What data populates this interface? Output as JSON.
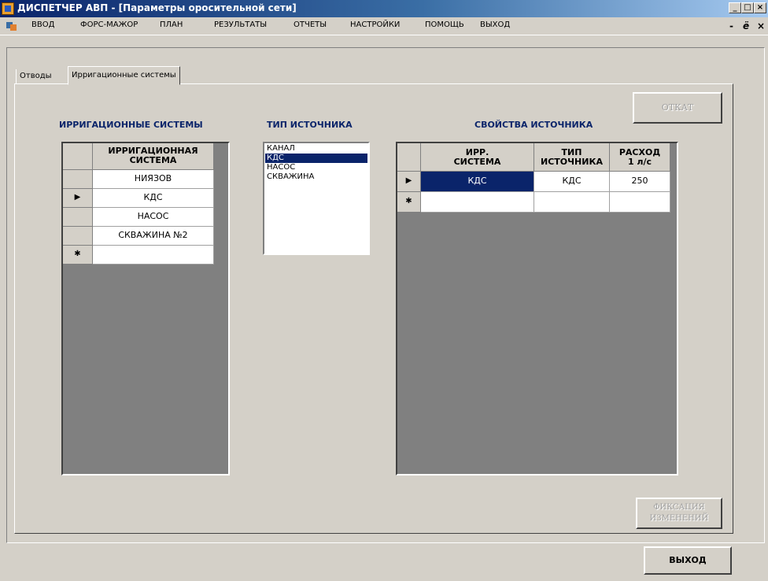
{
  "window": {
    "title": "ДИСПЕТЧЕР АВП - [Параметры оросительной сети]",
    "controls": {
      "minimize": "_",
      "maximize": "□",
      "close": "×"
    }
  },
  "menu": {
    "items": [
      "ВВОД",
      "ФОРС-МАЖОР",
      "ПЛАН",
      "РЕЗУЛЬТАТЫ",
      "ОТЧЕТЫ",
      "НАСТРОЙКИ",
      "ПОМОЩЬ",
      "ВЫХОД"
    ],
    "mdi_minimize": "-",
    "mdi_restore": "ё",
    "mdi_close": "×"
  },
  "tabs": [
    {
      "label": "Отводы",
      "active": false
    },
    {
      "label": "Ирригационные системы",
      "active": true
    }
  ],
  "irrigation_systems": {
    "title": "ИРРИГАЦИОННЫЕ СИСТЕМЫ",
    "header_line1": "ИРРИГАЦИОННАЯ",
    "header_line2": "СИСТЕМА",
    "rows": [
      "НИЯЗОВ",
      "КДС",
      "НАСОС",
      "СКВАЖИНА №2"
    ],
    "current_row_marker": "▶",
    "new_row_marker": "✱"
  },
  "source_type": {
    "title": "ТИП ИСТОЧНИКА",
    "options": [
      "КАНАЛ",
      "КДС",
      "НАСОС",
      "СКВАЖИНА"
    ],
    "selected": "КДС"
  },
  "source_properties": {
    "title": "СВОЙСТВА ИСТОЧНИКА",
    "columns": [
      {
        "line1": "ИРР.",
        "line2": "СИСТЕМА"
      },
      {
        "line1": "ТИП",
        "line2": "ИСТОЧНИКА"
      },
      {
        "line1": "РАСХОД",
        "line2": "1 л/с"
      }
    ],
    "rows": [
      [
        "КДС",
        "КДС",
        "250"
      ]
    ],
    "current_row_marker": "▶",
    "new_row_marker": "✱"
  },
  "buttons": {
    "rollback": "ОТКАТ",
    "commit_line1": "ФИКСАЦИЯ",
    "commit_line2": "ИЗМЕНЕНИЙ",
    "exit": "ВЫХОД"
  }
}
